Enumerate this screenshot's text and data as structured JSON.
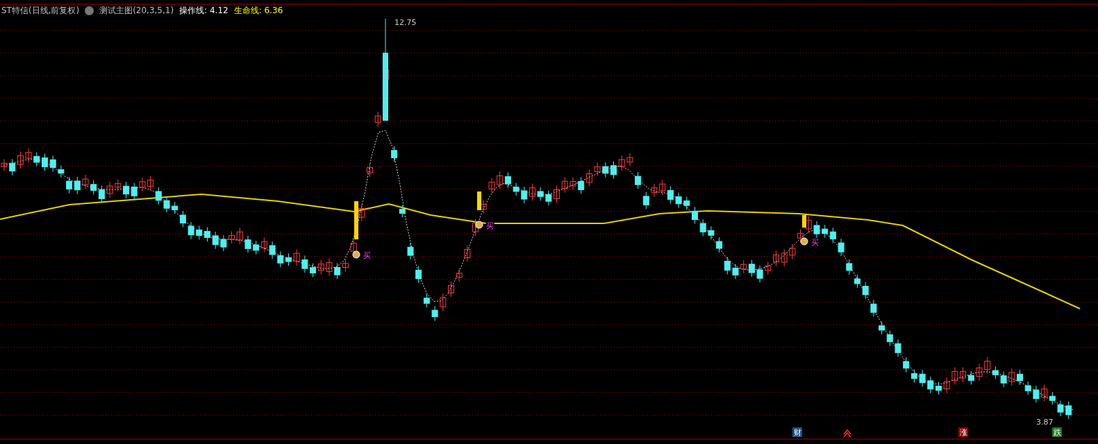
{
  "header": {
    "stock_title": "ST特信(日线,前复权)",
    "indicator_name": "测试主图(20,3,5,1)",
    "lines": [
      {
        "label": "操作线: 4.12",
        "color": "#ffffff"
      },
      {
        "label": "生命线: 6.36",
        "color": "#ffff00"
      }
    ]
  },
  "chart": {
    "high_label": "12.75",
    "low_label": "3.87",
    "signals": [
      "买",
      "买",
      "买"
    ]
  },
  "bottom_markers": [
    {
      "kind": "text",
      "text": "财",
      "color": "#1a4f8a"
    },
    {
      "kind": "arrows",
      "color": "#ff3030"
    },
    {
      "kind": "text",
      "text": "涨",
      "color": "#8b0000"
    },
    {
      "kind": "text",
      "text": "跌",
      "color": "#1f7a1f"
    }
  ]
}
